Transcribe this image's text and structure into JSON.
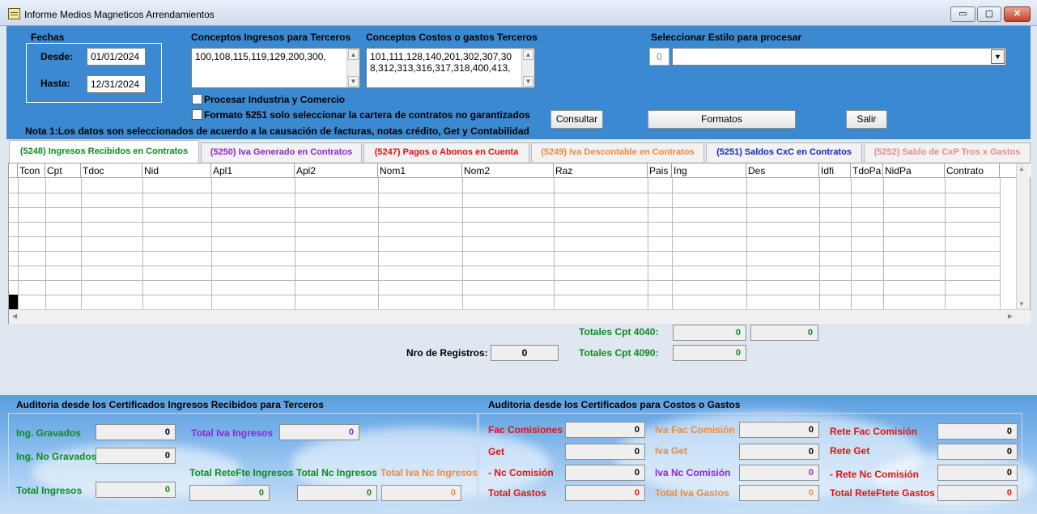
{
  "window": {
    "title": "Informe Medios Magneticos Arrendamientos",
    "min_glyph": "▭",
    "max_glyph": "▢",
    "close_glyph": "✕"
  },
  "fechas": {
    "label": "Fechas",
    "desde_label": "Desde:",
    "desde_value": "01/01/2024",
    "hasta_label": "Hasta:",
    "hasta_value": "12/31/2024"
  },
  "conceptos_ingresos": {
    "label": "Conceptos Ingresos para Terceros",
    "value": "100,108,115,119,129,200,300,"
  },
  "conceptos_costos": {
    "label": "Conceptos Costos o gastos Terceros",
    "value": "101,111,128,140,201,302,307,308,312,313,316,317,318,400,413,"
  },
  "estilo": {
    "label": "Seleccionar Estilo para procesar",
    "number": "0",
    "selected": ""
  },
  "options": {
    "industria": "Procesar  Industria y Comercio",
    "formato5251": "Formato 5251 solo seleccionar la cartera de contratos no garantizados"
  },
  "buttons": {
    "consultar": "Consultar",
    "formatos": "Formatos",
    "salir": "Salir"
  },
  "nota": "Nota 1:Los datos son seleccionados de acuerdo a la causación de facturas, notas crédito, Get y Contabilidad",
  "tabs": [
    {
      "label": "(5248) Ingresos Recibidos en Contratos",
      "color": "#0e8a1f"
    },
    {
      "label": "(5250) Iva Generado en Contratos",
      "color": "#8b27d6"
    },
    {
      "label": "(5247) Pagos o Abonos en Cuenta",
      "color": "#e01212"
    },
    {
      "label": "(5249) Iva Descontable en Contratos",
      "color": "#f0883a"
    },
    {
      "label": "(5251) Saldos CxC en Contratos",
      "color": "#1327c8"
    },
    {
      "label": "(5252) Saldo de CxP Tros x Gastos",
      "color": "#e88a8a"
    }
  ],
  "grid": {
    "columns": [
      "Tcon",
      "Cpt",
      "Tdoc",
      "Nid",
      "Apl1",
      "Apl2",
      "Nom1",
      "Nom2",
      "Raz",
      "Pais",
      "Ing",
      "Des",
      "Idfi",
      "TdoPa",
      "NidPa",
      "Contrato"
    ]
  },
  "totales": {
    "cpt4040_label": "Totales Cpt 4040:",
    "cpt4040_a": "0",
    "cpt4040_b": "0",
    "cpt4090_label": "Totales Cpt 4090:",
    "cpt4090_a": "0",
    "nro_label": "Nro de Registros:",
    "nro_value": "0"
  },
  "auditoria_ingresos": {
    "title": "Auditoria desde los Certificados Ingresos Recibidos para Terceros",
    "ing_gravados_label": "Ing. Gravados",
    "ing_gravados": "0",
    "ing_no_gravados_label": "Ing. No Gravados",
    "ing_no_gravados": "0",
    "total_iva_label": "Total Iva Ingresos",
    "total_iva": "0",
    "total_ingresos_label": "Total Ingresos",
    "total_ingresos": "0",
    "retefte_label": "Total ReteFte Ingresos",
    "retefte": "0",
    "nc_label": "Total Nc Ingresos",
    "nc": "0",
    "iva_nc_label": "Total Iva Nc Ingresos",
    "iva_nc": "0"
  },
  "auditoria_costos": {
    "title": "Auditoria desde los Certificados para Costos o Gastos",
    "fac_comisiones_label": "Fac Comisiones",
    "fac_comisiones": "0",
    "get_label": "Get",
    "get": "0",
    "nc_comision_label": "- Nc Comisión",
    "nc_comision": "0",
    "total_gastos_label": "Total Gastos",
    "total_gastos": "0",
    "iva_fac_label": "Iva Fac Comisión",
    "iva_fac": "0",
    "iva_get_label": "Iva Get",
    "iva_get": "0",
    "iva_nc_label": "Iva Nc Comisión",
    "iva_nc": "0",
    "total_iva_gastos_label": "Total Iva Gastos",
    "total_iva_gastos": "0",
    "rete_fac_label": "Rete Fac Comisión",
    "rete_fac": "0",
    "rete_get_label": "Rete Get",
    "rete_get": "0",
    "rete_nc_label": "- Rete Nc Comisión",
    "rete_nc": "0",
    "total_retefte_gastos_label": "Total ReteFtete Gastos",
    "total_retefte_gastos": "0"
  },
  "colors": {
    "top_panel": "#3a89d1",
    "green": "#0e8a1f",
    "purple": "#8b27d6",
    "orange": "#f0883a",
    "red": "#e01212",
    "blue": "#1327c8",
    "pink": "#e88a8a"
  }
}
